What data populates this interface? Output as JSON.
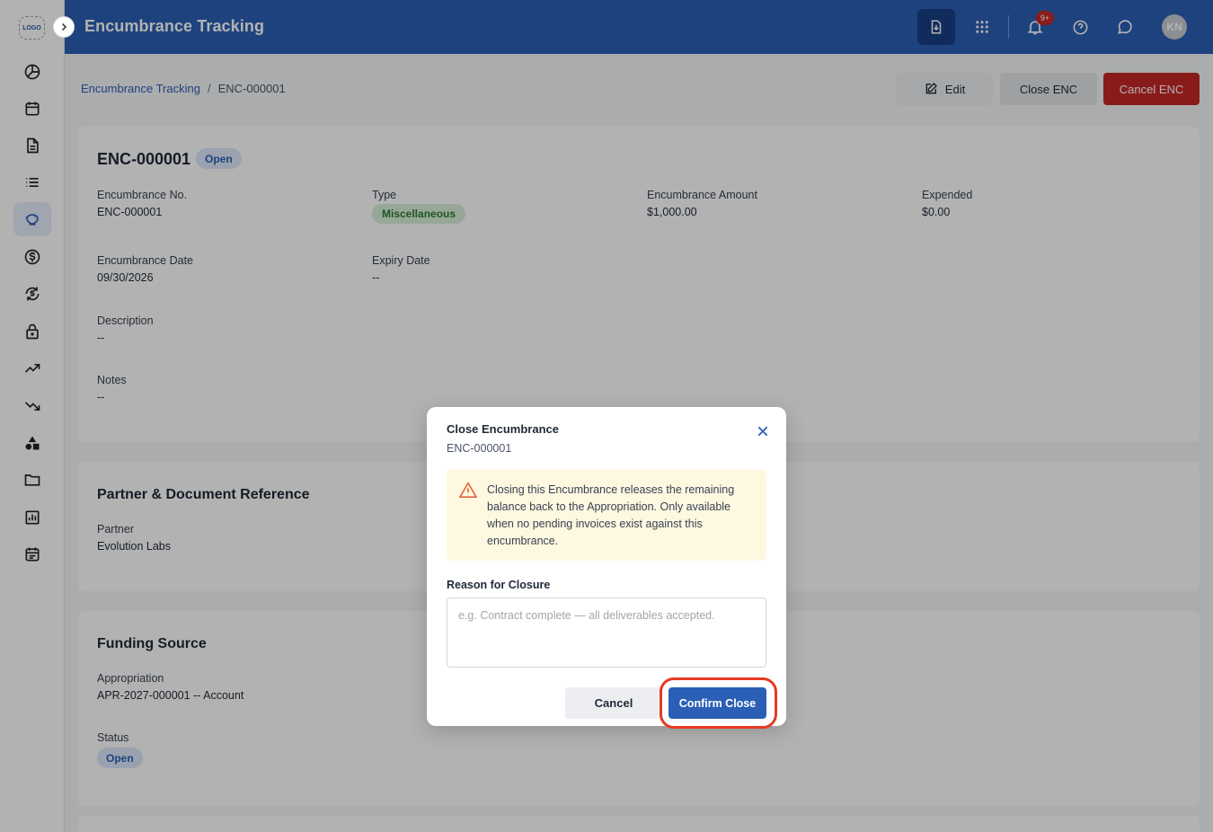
{
  "app": {
    "logo_text": "LOGO",
    "header_title": "Encumbrance Tracking",
    "notification_count": "9+",
    "user_initials": "KN",
    "colors": {
      "header": "#2b5fb5",
      "primary": "#2b5fb5",
      "danger": "#c62828",
      "warning_bg": "#fff8e1",
      "highlight": "#e53a25"
    }
  },
  "sidebar": {
    "icons": [
      "dashboard-icon",
      "calendar-icon",
      "document-icon",
      "list-icon",
      "piggy-bank-icon",
      "dollar-circle-icon",
      "refresh-dollar-icon",
      "lock-icon",
      "trending-up-icon",
      "trending-down-icon",
      "shapes-icon",
      "folder-icon",
      "report-chart-icon",
      "schedule-icon"
    ],
    "active_icon": "piggy-bank-icon"
  },
  "breadcrumb": {
    "parent": "Encumbrance Tracking",
    "separator": "/",
    "current": "ENC-000001"
  },
  "actions": {
    "edit": "Edit",
    "close": "Close ENC",
    "cancel": "Cancel ENC"
  },
  "details": {
    "title": "ENC-000001",
    "status": "Open",
    "encumbrance_no_label": "Encumbrance No.",
    "encumbrance_no": "ENC-000001",
    "type_label": "Type",
    "type": "Miscellaneous",
    "amount_label": "Encumbrance Amount",
    "amount": "$1,000.00",
    "expended_label": "Expended",
    "expended": "$0.00",
    "date_label": "Encumbrance Date",
    "date": "09/30/2026",
    "expiry_label": "Expiry Date",
    "expiry": "--",
    "description_label": "Description",
    "description": "--",
    "notes_label": "Notes",
    "notes": "--"
  },
  "partner": {
    "title": "Partner & Document Reference",
    "partner_label": "Partner",
    "partner": "Evolution Labs"
  },
  "funding": {
    "title": "Funding Source",
    "appropriation_label": "Appropriation",
    "appropriation": "APR-2027-000001 -- Account",
    "status_label": "Status",
    "status": "Open"
  },
  "modal": {
    "title": "Close Encumbrance",
    "subtitle": "ENC-000001",
    "warning": "Closing this Encumbrance releases the remaining balance back to the Appropriation. Only available when no pending invoices exist against this encumbrance.",
    "reason_label": "Reason for Closure",
    "reason_placeholder": "e.g. Contract complete — all deliverables accepted.",
    "reason_value": "",
    "cancel": "Cancel",
    "confirm": "Confirm Close"
  }
}
